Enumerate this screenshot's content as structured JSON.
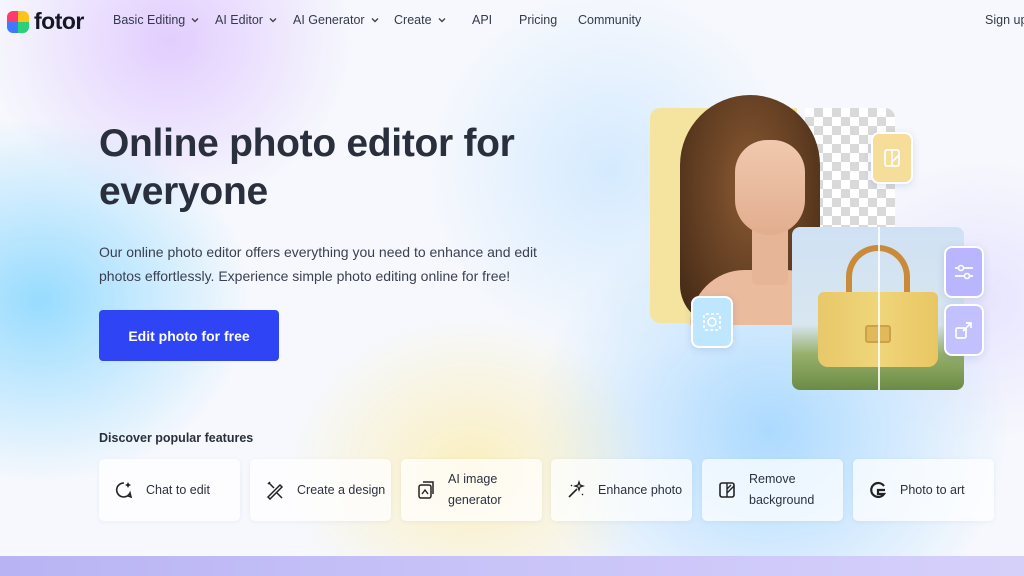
{
  "nav": {
    "logo_text": "fotor",
    "items": [
      {
        "label": "Basic Editing",
        "has_dropdown": true
      },
      {
        "label": "AI Editor",
        "has_dropdown": true
      },
      {
        "label": "AI Generator",
        "has_dropdown": true
      },
      {
        "label": "Create",
        "has_dropdown": true
      },
      {
        "label": "API",
        "has_dropdown": false
      },
      {
        "label": "Pricing",
        "has_dropdown": false
      },
      {
        "label": "Community",
        "has_dropdown": false
      }
    ],
    "sign_up": "Sign up"
  },
  "hero": {
    "title": "Online photo editor for everyone",
    "description": "Our online photo editor offers everything you need to enhance and edit photos effortlessly. Experience simple photo editing online for free!",
    "cta": "Edit photo for free"
  },
  "features": {
    "title": "Discover popular features",
    "items": [
      {
        "label": "Chat to edit",
        "icon": "chat-sparkle-icon"
      },
      {
        "label": "Create a design",
        "icon": "pen-ruler-icon"
      },
      {
        "label": "AI image generator",
        "icon": "ai-image-icon"
      },
      {
        "label": "Enhance photo",
        "icon": "magic-enhance-icon"
      },
      {
        "label": "Remove background",
        "icon": "remove-bg-icon"
      },
      {
        "label": "Photo to art",
        "icon": "art-g-icon"
      }
    ]
  },
  "colors": {
    "accent": "#2f45f5",
    "text_dark": "#2a2f3d"
  }
}
